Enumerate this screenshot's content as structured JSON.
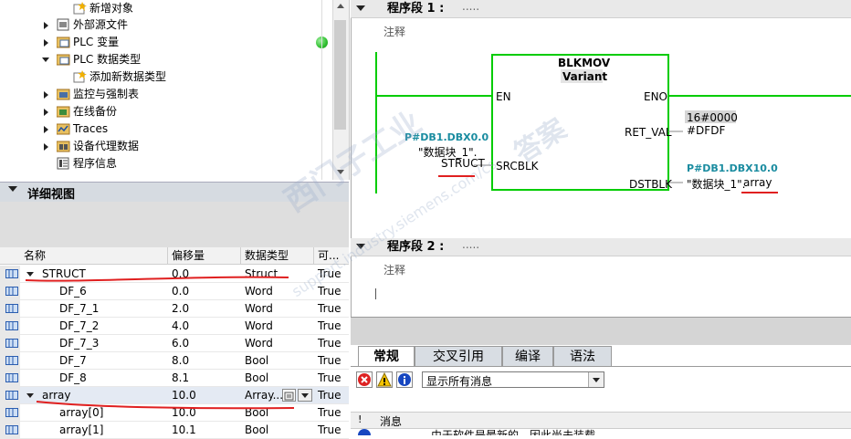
{
  "tree": {
    "items": [
      {
        "label": "新增对象",
        "icon": "add-object-icon"
      },
      {
        "label": "外部源文件",
        "icon": "external-source-icon"
      },
      {
        "label": "PLC 变量",
        "icon": "plc-tags-icon"
      },
      {
        "label": "PLC 数据类型",
        "icon": "plc-datatype-icon"
      },
      {
        "label": "添加新数据类型",
        "icon": "add-datatype-icon"
      },
      {
        "label": "监控与强制表",
        "icon": "watch-table-icon"
      },
      {
        "label": "在线备份",
        "icon": "online-backup-icon"
      },
      {
        "label": "Traces",
        "icon": "traces-icon"
      },
      {
        "label": "设备代理数据",
        "icon": "device-proxy-icon"
      },
      {
        "label": "程序信息",
        "icon": "program-info-icon"
      }
    ]
  },
  "detail_view": {
    "title": "详细视图",
    "columns": [
      "名称",
      "偏移量",
      "数据类型",
      "可..."
    ],
    "rows": [
      {
        "name": "STRUCT",
        "offset": "0.0",
        "type": "Struct",
        "retain": "True"
      },
      {
        "name": "DF_6",
        "offset": "0.0",
        "type": "Word",
        "retain": "True"
      },
      {
        "name": "DF_7_1",
        "offset": "2.0",
        "type": "Word",
        "retain": "True"
      },
      {
        "name": "DF_7_2",
        "offset": "4.0",
        "type": "Word",
        "retain": "True"
      },
      {
        "name": "DF_7_3",
        "offset": "6.0",
        "type": "Word",
        "retain": "True"
      },
      {
        "name": "DF_7",
        "offset": "8.0",
        "type": "Bool",
        "retain": "True"
      },
      {
        "name": "DF_8",
        "offset": "8.1",
        "type": "Bool",
        "retain": "True"
      },
      {
        "name": "array",
        "offset": "10.0",
        "type": "Array...",
        "retain": "True"
      },
      {
        "name": "array[0]",
        "offset": "10.0",
        "type": "Bool",
        "retain": "True"
      },
      {
        "name": "array[1]",
        "offset": "10.1",
        "type": "Bool",
        "retain": "True"
      }
    ]
  },
  "editor": {
    "segment1": {
      "title": "程序段 1 :",
      "dots": ".....",
      "comment": "注释"
    },
    "segment2": {
      "title": "程序段 2 :",
      "dots": ".....",
      "comment": "注释"
    },
    "block": {
      "name": "BLKMOV",
      "subtype": "Variant",
      "en": "EN",
      "eno": "ENO",
      "ret_val": "RET_VAL",
      "srcblk": "SRCBLK",
      "dstblk": "DSTBLK"
    },
    "src_address": "P#DB1.DBX0.0",
    "src_db": "\"数据块_1\".",
    "src_member": "STRUCT",
    "ret_value": "16#0000",
    "ret_tag": "#DFDF",
    "dst_address": "P#DB1.DBX10.0",
    "dst_db": "\"数据块_1\".",
    "dst_member": "array"
  },
  "watermark": {
    "text1": "西门子工业",
    "text2": "support.industry.siemens.com/cs",
    "text3": "答案"
  },
  "bottom": {
    "tabs": [
      "常规",
      "交叉引用",
      "编译",
      "语法"
    ],
    "filter_value": "显示所有消息",
    "message_header_mark": "!",
    "message_header": "消息",
    "message_text": "由于软件是最新的，因此尚未装载。"
  },
  "colors": {
    "network_green": "#00cc00",
    "address_teal": "#1a8ca0",
    "annotation_red": "#e02020",
    "status_green": "#2fbf2f"
  }
}
